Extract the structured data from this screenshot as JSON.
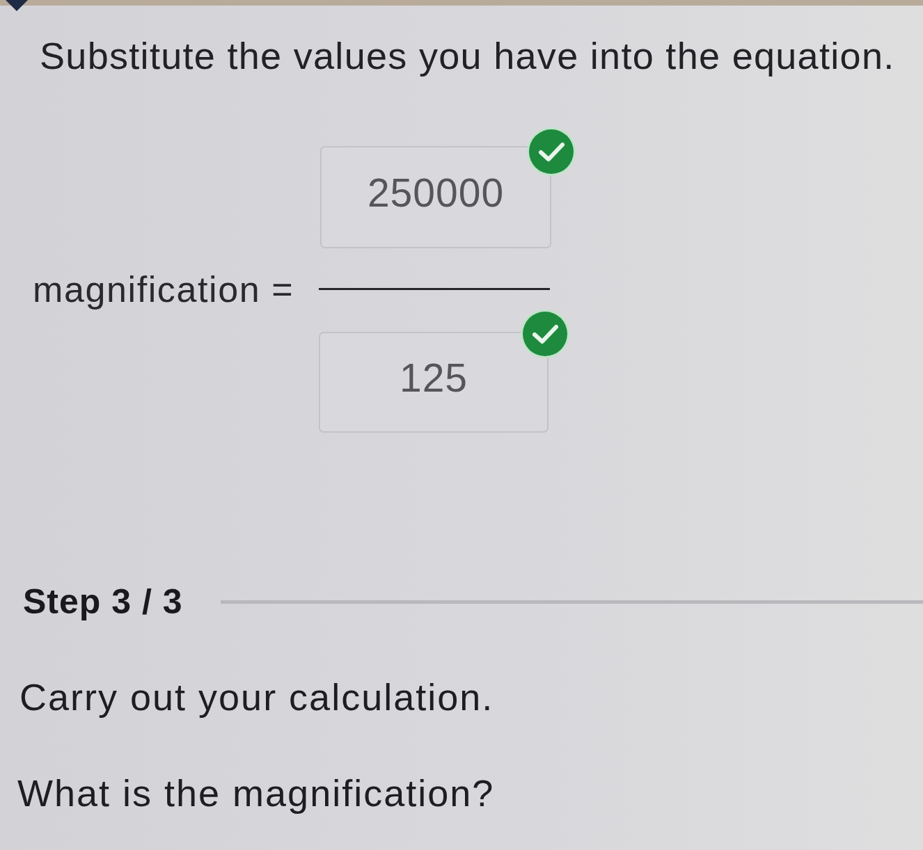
{
  "instruction": "Substitute the values you have into the equation.",
  "equation": {
    "label": "magnification =",
    "numerator": {
      "value": "250000",
      "correct": true
    },
    "denominator": {
      "value": "125",
      "correct": true
    }
  },
  "step": {
    "label": "Step 3 / 3"
  },
  "prompts": [
    "Carry out your calculation.",
    "What is the magnification?"
  ]
}
